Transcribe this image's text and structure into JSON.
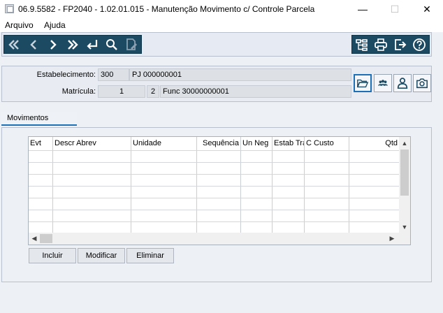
{
  "window": {
    "title": "06.9.5582 - FP2040 - 1.02.01.015 - Manutenção Movimento c/ Controle Parcela",
    "minimize_glyph": "—",
    "maximize_glyph": "☐",
    "close_glyph": "✕"
  },
  "menu": {
    "items": [
      "Arquivo",
      "Ajuda"
    ]
  },
  "toolbar": {
    "nav_icons": [
      "first-icon",
      "previous-icon",
      "next-icon",
      "last-icon",
      "goto-icon",
      "search-icon",
      "edit-document-icon"
    ],
    "right_icons": [
      "tree-icon",
      "print-icon",
      "exit-icon",
      "help-icon"
    ],
    "accent_color": "#1c4a63"
  },
  "header": {
    "estabelecimento_label": "Estabelecimento:",
    "estabelecimento_code": "300",
    "estabelecimento_name": "PJ 000000001",
    "matricula_label": "Matrícula:",
    "matricula_value": "1",
    "matricula_seq": "2",
    "matricula_name": "Func 30000000001",
    "side_icons": [
      "open-folder-icon",
      "group-icon",
      "person-icon",
      "camera-icon"
    ]
  },
  "tab": {
    "label": "Movimentos"
  },
  "grid": {
    "columns": [
      "Evt",
      "Descr Abrev",
      "Unidade",
      "Sequência",
      "Un Neg",
      "Estab Tra",
      "C Custo",
      "Qtd"
    ],
    "rows": [],
    "visible_empty_rows": 6
  },
  "buttons": {
    "incluir": "Incluir",
    "modificar": "Modificar",
    "eliminar": "Eliminar"
  }
}
